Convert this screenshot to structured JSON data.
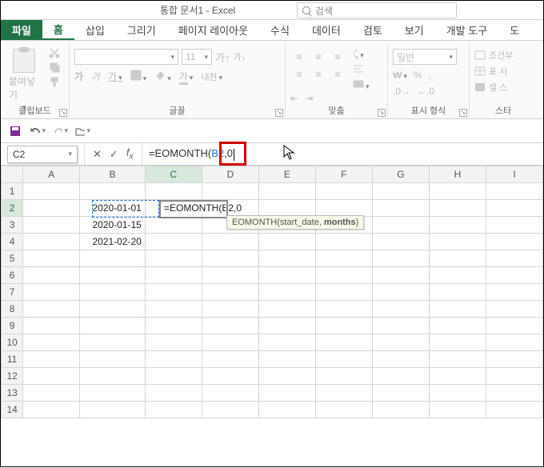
{
  "title": "통합 문서1 - Excel",
  "search": {
    "placeholder": "검색"
  },
  "tabs": {
    "file": "파일",
    "home": "홈",
    "insert": "삽입",
    "draw": "그리기",
    "layout": "페이지 레이아웃",
    "formulas": "수식",
    "data": "데이터",
    "review": "검토",
    "view": "보기",
    "developer": "개발 도구",
    "more": "도"
  },
  "ribbon": {
    "clipboard": {
      "paste": "붙여넣기",
      "label": "클립보드"
    },
    "font": {
      "sample_label": "가",
      "placeholder_size": "11",
      "grow": "가",
      "shrink": "가",
      "wrap_btn": "내천",
      "label": "글꼴"
    },
    "alignment": {
      "label": "맞춤"
    },
    "number": {
      "format": "일반",
      "label": "표시 형식"
    },
    "styles": {
      "cond": "조건부",
      "table": "표 서",
      "cell": "셀 스",
      "label": "스타"
    }
  },
  "formula_bar": {
    "name_box": "C2",
    "formula_prefix": "=EOMONTH(",
    "formula_ref": "B2",
    "formula_suffix": ",0",
    "tooltip_fn": "EOMONTH(",
    "tooltip_arg1": "start_date",
    "tooltip_sep": ", ",
    "tooltip_arg2": "months",
    "tooltip_close": ")"
  },
  "columns": [
    "A",
    "B",
    "C",
    "D",
    "E",
    "F",
    "G",
    "H",
    "I"
  ],
  "rows": [
    1,
    2,
    3,
    4,
    5,
    6,
    7,
    8,
    9,
    10,
    11,
    12,
    13,
    14
  ],
  "cells": {
    "B2": "2020-01-01",
    "B3": "2020-01-15",
    "B4": "2021-02-20",
    "C2_display": "=EOMONTH(B2,0"
  },
  "colors": {
    "accent": "#217346",
    "ref_blue": "#1f6fd0",
    "highlight_red": "#d00000"
  }
}
